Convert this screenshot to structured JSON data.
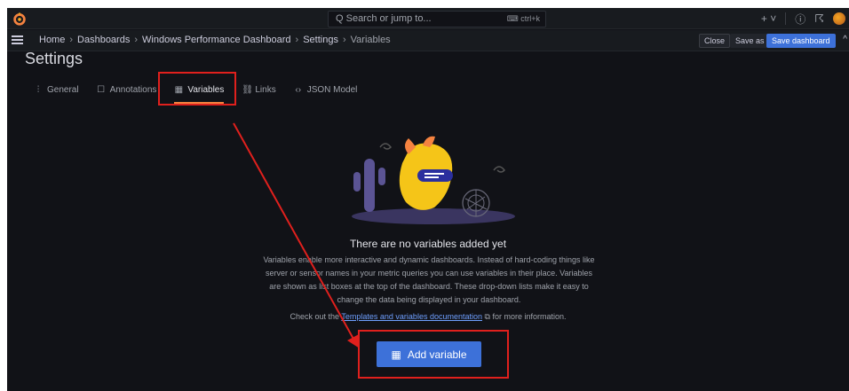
{
  "topnav": {
    "logo_icon": "grafana-logo-icon",
    "search_placeholder": "Q Search or jump to...",
    "search_shortcut": "⌨ ctrl+k",
    "add_icon": "+ ˅",
    "help_icon": "?",
    "news_icon": "rss-icon"
  },
  "breadcrumb": {
    "items": [
      "Home",
      "Dashboards",
      "Windows Performance Dashboard",
      "Settings",
      "Variables"
    ],
    "separator": "›"
  },
  "actions": {
    "close_label": "Close",
    "save_as_label": "Save as",
    "save_dashboard_label": "Save dashboard",
    "collapse_icon": "^"
  },
  "settings": {
    "title": "Settings",
    "tabs": [
      {
        "icon": "⫶",
        "label": "General"
      },
      {
        "icon": "☐",
        "label": "Annotations"
      },
      {
        "icon": "▦",
        "label": "Variables"
      },
      {
        "icon": "⛓",
        "label": "Links"
      },
      {
        "icon": "‹›",
        "label": "JSON Model"
      }
    ],
    "active_tab": "Variables"
  },
  "empty_state": {
    "title": "There are no variables added yet",
    "description": "Variables enable more interactive and dynamic dashboards. Instead of hard-coding things like server or sensor names in your metric queries you can use variables in their place. Variables are shown as list boxes at the top of the dashboard. These drop-down lists make it easy to change the data being displayed in your dashboard.",
    "help_prefix": "Check out the ",
    "help_link": "Templates and variables documentation",
    "help_suffix": " for more information.",
    "add_button_label": "Add variable"
  },
  "colors": {
    "accent": "#3d71d9",
    "annotation_red": "#e0201d",
    "active_tab_underline": "#f58340"
  }
}
